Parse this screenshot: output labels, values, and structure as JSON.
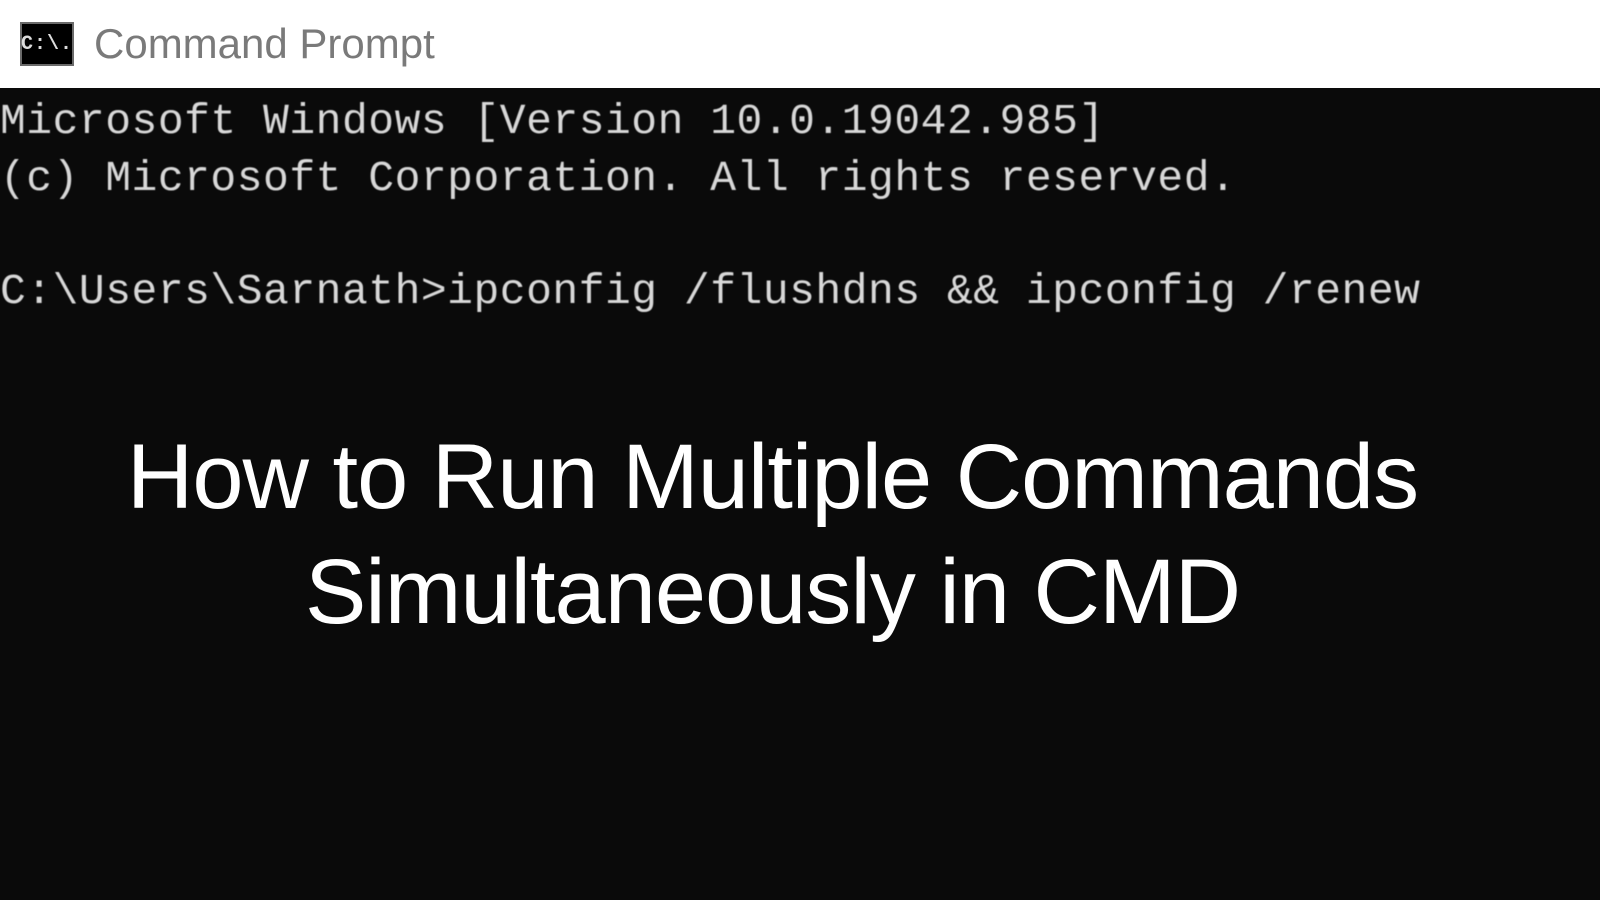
{
  "window": {
    "icon_label": "C:\\.",
    "title": "Command Prompt"
  },
  "terminal": {
    "line1": "Microsoft Windows [Version 10.0.19042.985]",
    "line2": "(c) Microsoft Corporation. All rights reserved.",
    "prompt": "C:\\Users\\Sarnath>",
    "command": "ipconfig /flushdns && ipconfig /renew"
  },
  "overlay": {
    "heading": "How to Run Multiple Commands Simultaneously in CMD"
  }
}
